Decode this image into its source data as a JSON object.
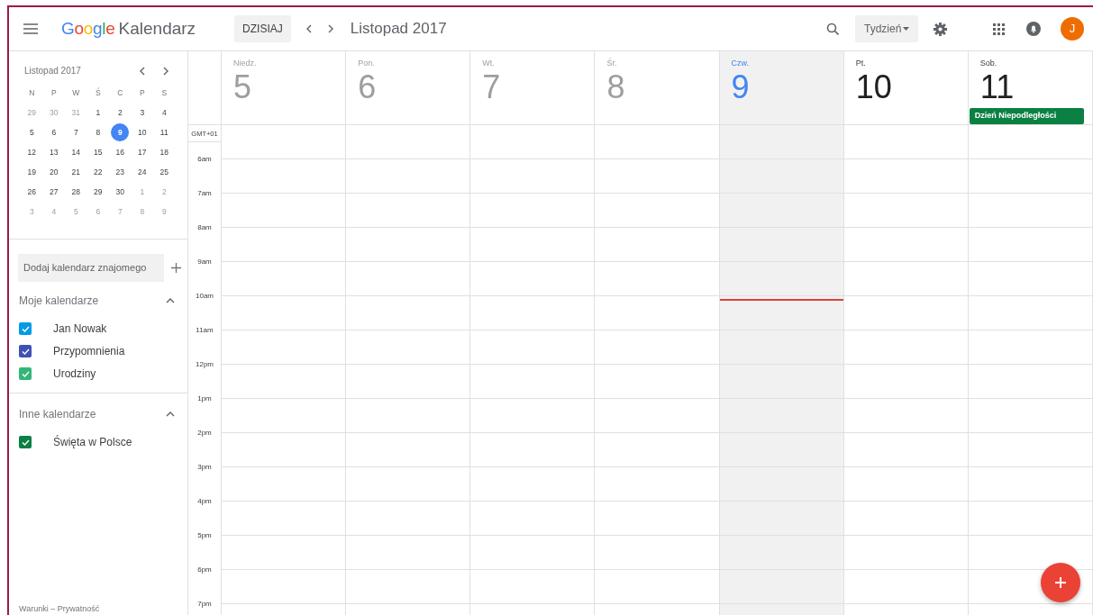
{
  "header": {
    "logo": "Google",
    "app_name": "Kalendarz",
    "today_button": "DZISIAJ",
    "period": "Listopad 2017",
    "view": "Tydzień",
    "avatar": "J"
  },
  "mini_calendar": {
    "title": "Listopad 2017",
    "weekdays": [
      "N",
      "P",
      "W",
      "Ś",
      "C",
      "P",
      "S"
    ],
    "weeks": [
      [
        {
          "day": "29",
          "in_month": false,
          "selected": false
        },
        {
          "day": "30",
          "in_month": false,
          "selected": false
        },
        {
          "day": "31",
          "in_month": false,
          "selected": false
        },
        {
          "day": "1",
          "in_month": true,
          "selected": false
        },
        {
          "day": "2",
          "in_month": true,
          "selected": false
        },
        {
          "day": "3",
          "in_month": true,
          "selected": false
        },
        {
          "day": "4",
          "in_month": true,
          "selected": false
        }
      ],
      [
        {
          "day": "5",
          "in_month": true,
          "selected": false
        },
        {
          "day": "6",
          "in_month": true,
          "selected": false
        },
        {
          "day": "7",
          "in_month": true,
          "selected": false
        },
        {
          "day": "8",
          "in_month": true,
          "selected": false
        },
        {
          "day": "9",
          "in_month": true,
          "selected": true
        },
        {
          "day": "10",
          "in_month": true,
          "selected": false
        },
        {
          "day": "11",
          "in_month": true,
          "selected": false
        }
      ],
      [
        {
          "day": "12",
          "in_month": true,
          "selected": false
        },
        {
          "day": "13",
          "in_month": true,
          "selected": false
        },
        {
          "day": "14",
          "in_month": true,
          "selected": false
        },
        {
          "day": "15",
          "in_month": true,
          "selected": false
        },
        {
          "day": "16",
          "in_month": true,
          "selected": false
        },
        {
          "day": "17",
          "in_month": true,
          "selected": false
        },
        {
          "day": "18",
          "in_month": true,
          "selected": false
        }
      ],
      [
        {
          "day": "19",
          "in_month": true,
          "selected": false
        },
        {
          "day": "20",
          "in_month": true,
          "selected": false
        },
        {
          "day": "21",
          "in_month": true,
          "selected": false
        },
        {
          "day": "22",
          "in_month": true,
          "selected": false
        },
        {
          "day": "23",
          "in_month": true,
          "selected": false
        },
        {
          "day": "24",
          "in_month": true,
          "selected": false
        },
        {
          "day": "25",
          "in_month": true,
          "selected": false
        }
      ],
      [
        {
          "day": "26",
          "in_month": true,
          "selected": false
        },
        {
          "day": "27",
          "in_month": true,
          "selected": false
        },
        {
          "day": "28",
          "in_month": true,
          "selected": false
        },
        {
          "day": "29",
          "in_month": true,
          "selected": false
        },
        {
          "day": "30",
          "in_month": true,
          "selected": false
        },
        {
          "day": "1",
          "in_month": false,
          "selected": false
        },
        {
          "day": "2",
          "in_month": false,
          "selected": false
        }
      ],
      [
        {
          "day": "3",
          "in_month": false,
          "selected": false
        },
        {
          "day": "4",
          "in_month": false,
          "selected": false
        },
        {
          "day": "5",
          "in_month": false,
          "selected": false
        },
        {
          "day": "6",
          "in_month": false,
          "selected": false
        },
        {
          "day": "7",
          "in_month": false,
          "selected": false
        },
        {
          "day": "8",
          "in_month": false,
          "selected": false
        },
        {
          "day": "9",
          "in_month": false,
          "selected": false
        }
      ]
    ]
  },
  "add_calendar": {
    "placeholder": "Dodaj kalendarz znajomego"
  },
  "sections": [
    {
      "title": "Moje kalendarze",
      "expanded": true,
      "calendars": [
        {
          "name": "Jan Nowak",
          "checked": true,
          "color": "#039be5"
        },
        {
          "name": "Przypomnienia",
          "checked": true,
          "color": "#3f51b5"
        },
        {
          "name": "Urodziny",
          "checked": true,
          "color": "#33b679"
        }
      ]
    },
    {
      "title": "Inne kalendarze",
      "expanded": true,
      "calendars": [
        {
          "name": "Święta w Polsce",
          "checked": true,
          "color": "#0b8043"
        }
      ]
    }
  ],
  "footer": "Warunki – Prywatność",
  "week": {
    "time_zone": "GMT+01",
    "hours": [
      "6am",
      "7am",
      "8am",
      "9am",
      "10am",
      "11am",
      "12pm",
      "1pm",
      "2pm",
      "3pm",
      "4pm",
      "5pm",
      "6pm",
      "7pm"
    ],
    "days": [
      {
        "weekday": "Niedz.",
        "date": "5",
        "past": true,
        "selected": false,
        "now_line": false
      },
      {
        "weekday": "Pon.",
        "date": "6",
        "past": true,
        "selected": false,
        "now_line": false
      },
      {
        "weekday": "Wt.",
        "date": "7",
        "past": true,
        "selected": false,
        "now_line": false
      },
      {
        "weekday": "Śr.",
        "date": "8",
        "past": true,
        "selected": false,
        "now_line": false
      },
      {
        "weekday": "Czw.",
        "date": "9",
        "past": false,
        "selected": true,
        "now_line": true
      },
      {
        "weekday": "Pt.",
        "date": "10",
        "past": false,
        "selected": false,
        "now_line": false
      },
      {
        "weekday": "Sob.",
        "date": "11",
        "past": false,
        "selected": false,
        "now_line": false,
        "events": [
          {
            "title": "Dzień Niepodległości",
            "color": "#0b8043"
          }
        ]
      }
    ]
  }
}
